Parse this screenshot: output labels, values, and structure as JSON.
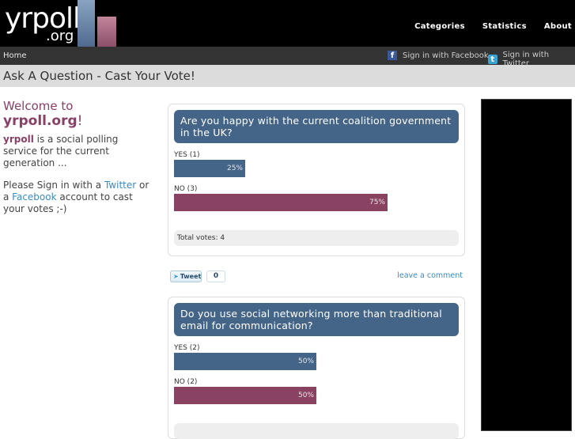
{
  "header": {
    "logo_main": "yrpoll",
    "logo_tld": ".org",
    "nav": [
      "Categories",
      "Statistics",
      "About"
    ]
  },
  "subbar": {
    "home": "Home",
    "signin_facebook": "Sign in with Facebook",
    "signin_twitter": "Sign in with Twitter",
    "facebook_icon": "f",
    "twitter_icon": "t"
  },
  "page_title": "Ask A Question - Cast Your Vote!",
  "welcome": {
    "line1": "Welcome to",
    "site": "yrpoll.org",
    "bang": "!",
    "brand": "yrpoll",
    "desc": " is a social polling service for the current generation ...",
    "signin_pre": "Please Sign in with a ",
    "twitter": "Twitter",
    "or": " or a ",
    "facebook": "Facebook",
    "signin_post": " account to cast your votes ;-)"
  },
  "polls": [
    {
      "question": "Are you happy with the current coalition government in the UK?",
      "options": [
        {
          "label": "YES (1)",
          "percent": 25,
          "percent_text": "25%"
        },
        {
          "label": "NO (3)",
          "percent": 75,
          "percent_text": "75%"
        }
      ],
      "total": "Total votes: 4"
    },
    {
      "question": "Do you use social networking more than traditional email for communication?",
      "options": [
        {
          "label": "YES (2)",
          "percent": 50,
          "percent_text": "50%"
        },
        {
          "label": "NO (2)",
          "percent": 50,
          "percent_text": "50%"
        }
      ]
    }
  ],
  "social": {
    "tweet": "Tweet",
    "count": "0",
    "leave_comment": "leave a comment"
  },
  "colors": {
    "yes": "#446488",
    "no": "#8a4262",
    "accent": "#8a3f66",
    "link": "#3a8bbf"
  }
}
